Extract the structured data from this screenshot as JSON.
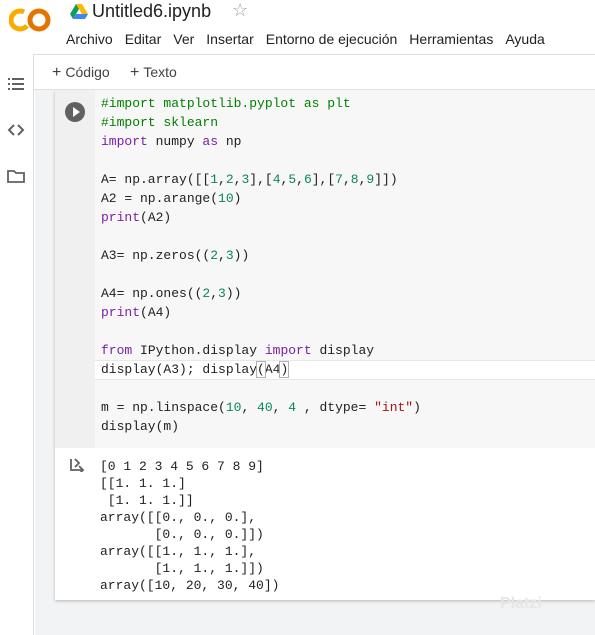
{
  "header": {
    "title": "Untitled6.ipynb",
    "menu": [
      "Archivo",
      "Editar",
      "Ver",
      "Insertar",
      "Entorno de ejecución",
      "Herramientas",
      "Ayuda"
    ]
  },
  "toolbar": {
    "add_code": "Código",
    "add_text": "Texto"
  },
  "cell": {
    "cut_line": "#import matplotlib.pyplot as plt",
    "output": [
      "[0 1 2 3 4 5 6 7 8 9]",
      "[[1. 1. 1.]",
      " [1. 1. 1.]]",
      "array([[0., 0., 0.],",
      "       [0., 0., 0.]])",
      "array([[1., 1., 1.],",
      "       [1., 1., 1.]])",
      "array([10, 20, 30, 40])"
    ]
  },
  "watermark": "Platzi",
  "colors": {
    "logo_orange": "#f9ab00",
    "logo_dark_orange": "#e37400",
    "keyword": "#7b1fa2",
    "number": "#098658",
    "string": "#a31515",
    "comment": "#008000"
  }
}
